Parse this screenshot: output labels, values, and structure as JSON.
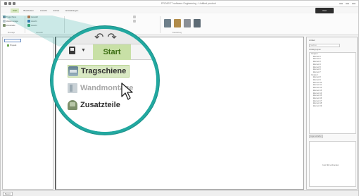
{
  "app": {
    "window_title": "PROJECT software Engineering - Untitled product",
    "user_area": "User"
  },
  "ribbon": {
    "tabs": [
      "Start",
      "Bearbeiten",
      "Ansicht",
      "Extras",
      "Einstellungen"
    ],
    "active_tab_index": 0,
    "commands": {
      "tragschiene": "Tragschiene",
      "wandmontage": "Wandmontage",
      "zusatzteile": "Zusatzteile",
      "auswahl": "Auswahl",
      "ansicht_a": "Ansicht",
      "ansicht_b": "Ansicht"
    },
    "groups": {
      "montage": "Montage",
      "auswahl": "Auswahl",
      "darstellung": "Darstellung"
    }
  },
  "left_panel": {
    "tree_root": "Projekt"
  },
  "right_panel": {
    "title": "Artikel",
    "search_placeholder": "Suchen",
    "list_header": "Artikelgruppen",
    "list_items": [
      {
        "label": "Gruppe 1",
        "group": true
      },
      {
        "label": "Element 1",
        "group": false
      },
      {
        "label": "Element 2",
        "group": false
      },
      {
        "label": "Element 3",
        "group": false
      },
      {
        "label": "Element 4",
        "group": false
      },
      {
        "label": "Element 5",
        "group": false
      },
      {
        "label": "Element 6",
        "group": false
      },
      {
        "label": "Element 7",
        "group": false
      },
      {
        "label": "Gruppe 2",
        "group": true
      },
      {
        "label": "Element 8",
        "group": false
      },
      {
        "label": "Element 9",
        "group": false
      },
      {
        "label": "Element 10",
        "group": false
      },
      {
        "label": "Element 11",
        "group": false
      },
      {
        "label": "Element 12",
        "group": false
      },
      {
        "label": "Element 13",
        "group": false
      },
      {
        "label": "Element 14",
        "group": false
      },
      {
        "label": "Element 15",
        "group": false
      },
      {
        "label": "Element 16",
        "group": false
      },
      {
        "label": "Element 17",
        "group": false
      },
      {
        "label": "Element 18",
        "group": false
      },
      {
        "label": "Element 19",
        "group": false
      }
    ],
    "sub_tab": "Eigenschaften",
    "preview_message": "Kein Bild vorhanden"
  },
  "status_bar": {
    "label": "Bereit"
  },
  "magnifier": {
    "start_tab": "Start",
    "items": [
      "Tragschiene",
      "Wandmontage",
      "Zusatzteile"
    ],
    "highlighted_index": 0,
    "accent_color": "#22a8a0",
    "highlight_color": "#d9e9c3"
  }
}
